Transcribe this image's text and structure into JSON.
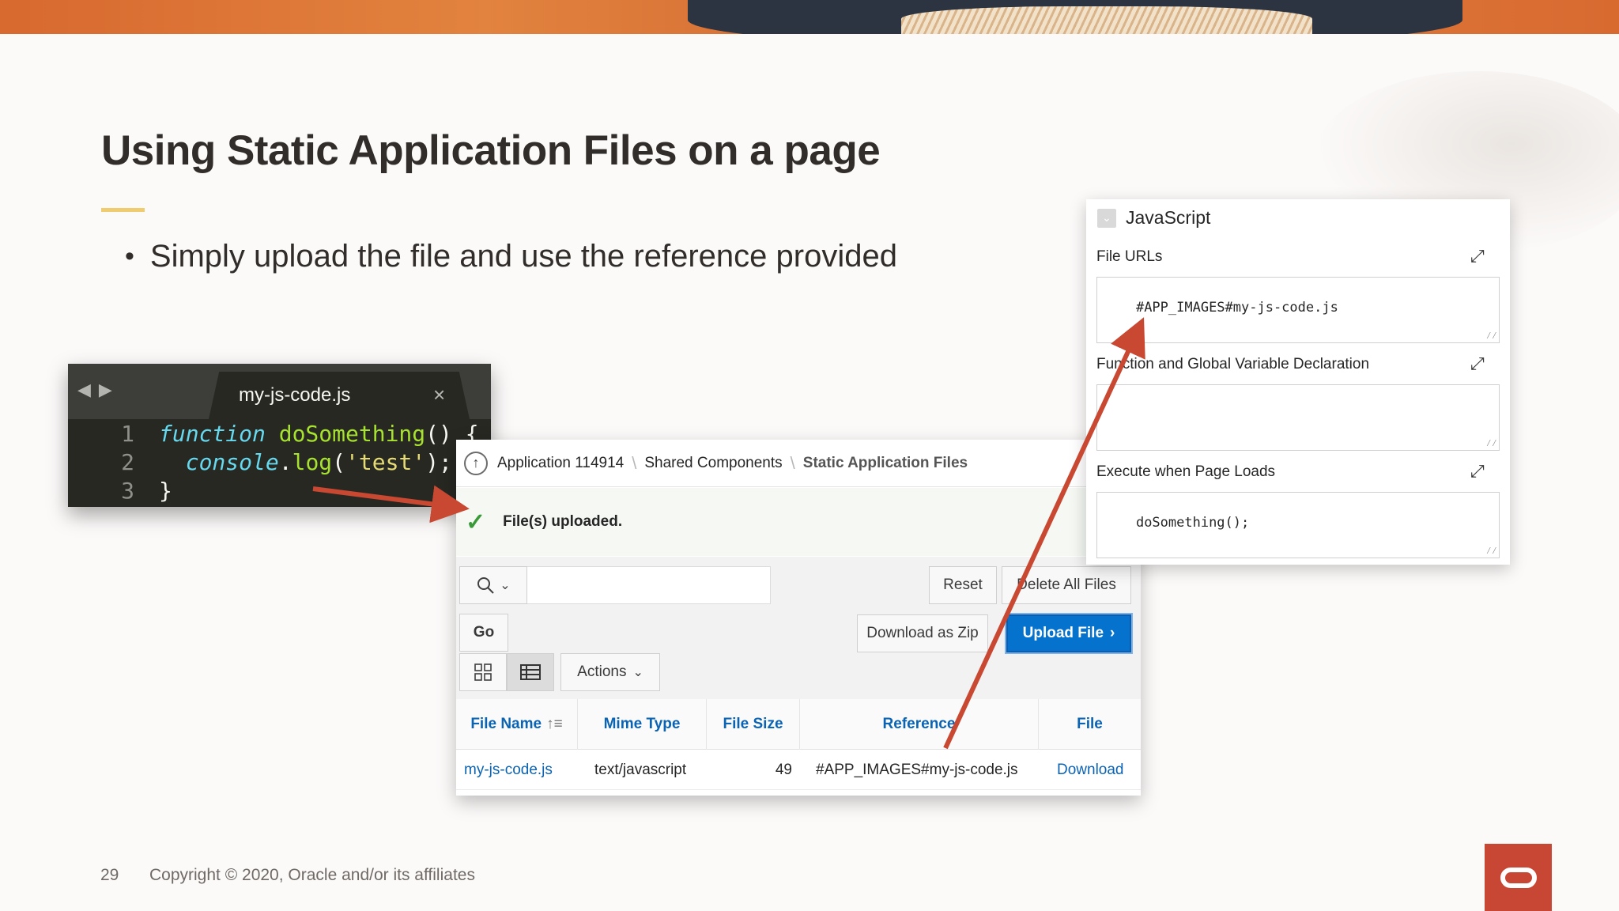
{
  "slide": {
    "title": "Using Static Application Files on a page",
    "bullet": "Simply upload the file and use the reference provided",
    "page_number": "29",
    "copyright": "Copyright © 2020, Oracle and/or its affiliates",
    "accent_color": "#f0cc71",
    "logo_color": "#c74634"
  },
  "editor": {
    "tab_label": "my-js-code.js",
    "close_glyph": "×",
    "lines": [
      {
        "num": "1"
      },
      {
        "num": "2"
      },
      {
        "num": "3"
      }
    ]
  },
  "apex": {
    "breadcrumb": {
      "app": "Application 114914",
      "shared": "Shared Components",
      "current": "Static Application Files",
      "separator": "\\"
    },
    "message": "File(s) uploaded.",
    "toolbar": {
      "go_label": "Go",
      "reset_label": "Reset",
      "delete_label": "Delete All Files",
      "zip_label": "Download as Zip",
      "upload_label": "Upload File",
      "actions_label": "Actions"
    },
    "columns": {
      "file_name": "File Name",
      "mime_type": "Mime Type",
      "file_size": "File Size",
      "reference": "Reference",
      "file": "File"
    },
    "rows": [
      {
        "file_name": "my-js-code.js",
        "mime_type": "text/javascript",
        "file_size": "49",
        "reference": "#APP_IMAGES#my-js-code.js",
        "file": "Download"
      }
    ],
    "primary_color": "#0572ce"
  },
  "js_panel": {
    "title": "JavaScript",
    "file_urls_label": "File URLs",
    "file_urls_value": "#APP_IMAGES#my-js-code.js",
    "function_label": "Function and Global Variable Declaration",
    "function_value": "",
    "onload_label": "Execute when Page Loads",
    "onload_value": "doSomething();"
  },
  "annotation_color": "#c84832"
}
